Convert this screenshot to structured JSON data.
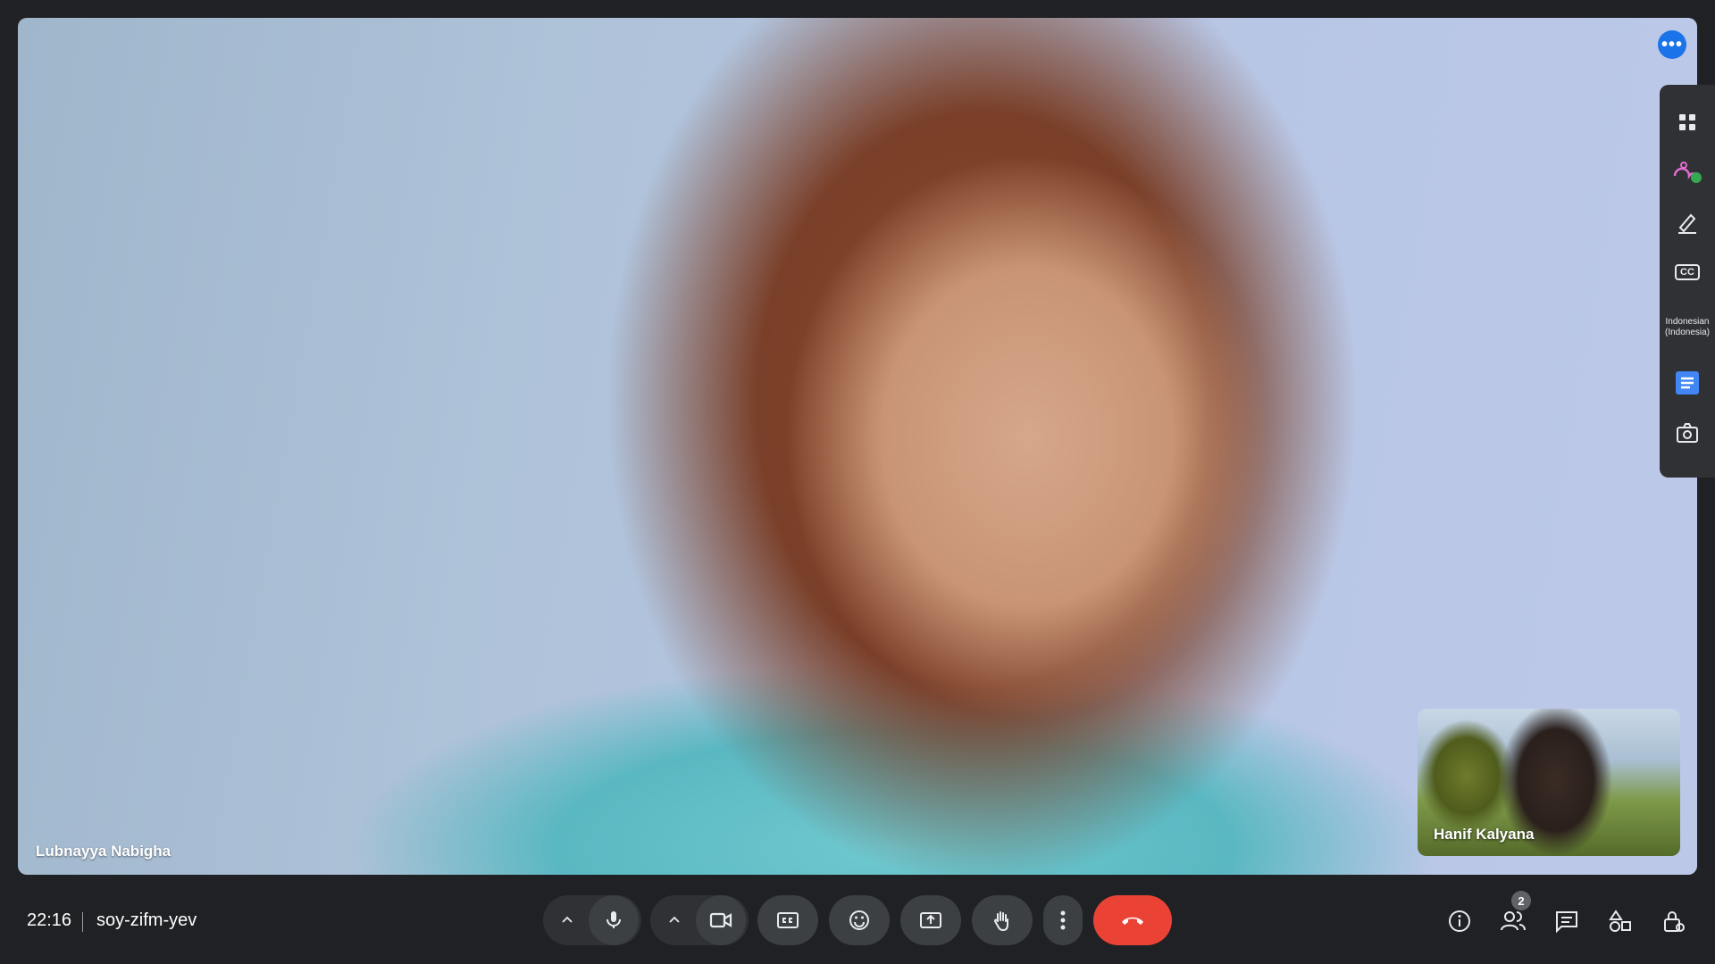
{
  "stage": {
    "participant_name": "Lubnayya Nabigha"
  },
  "pip": {
    "participant_name": "Hanif Kalyana"
  },
  "side_panel": {
    "language_label": "Indonesian (Indonesia)",
    "cc_label": "CC"
  },
  "bottom_bar": {
    "time": "22:16",
    "meeting_code": "soy-zifm-yev",
    "people_count": "2"
  },
  "colors": {
    "end_call": "#ea4335",
    "accent": "#1a73e8",
    "background": "#202124"
  }
}
